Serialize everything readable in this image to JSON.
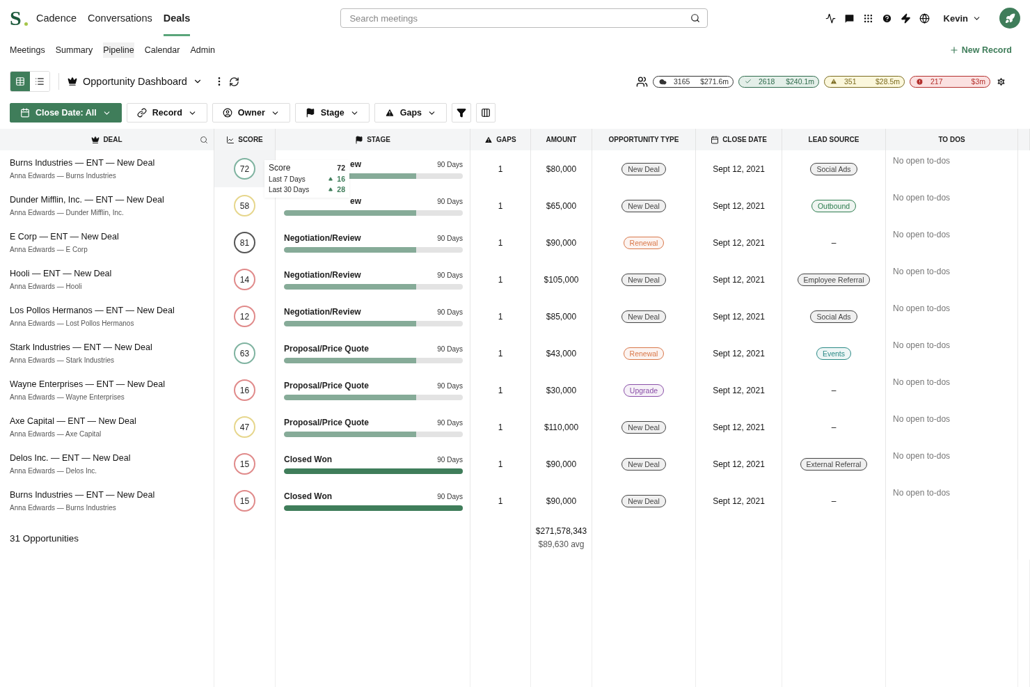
{
  "nav": {
    "logo": "S",
    "items": [
      {
        "label": "Cadence",
        "selected": false
      },
      {
        "label": "Conversations",
        "selected": false
      },
      {
        "label": "Deals",
        "selected": true
      }
    ],
    "search": {
      "placeholder": "Search meetings"
    },
    "user": "Kevin"
  },
  "subnav": {
    "items": [
      {
        "label": "Meetings",
        "selected": false
      },
      {
        "label": "Summary",
        "selected": false
      },
      {
        "label": "Pipeline",
        "selected": true
      },
      {
        "label": "Calendar",
        "selected": false
      },
      {
        "label": "Admin",
        "selected": false
      }
    ],
    "action": "New Record"
  },
  "dashboard": {
    "views": [
      {
        "kind": "grid",
        "selected": true
      },
      {
        "kind": "list",
        "selected": false
      }
    ],
    "title": "Opportunity Dashboard",
    "stats": [
      {
        "kind": "all",
        "count": "3165",
        "amount": "$271.6m"
      },
      {
        "kind": "won",
        "count": "2618",
        "amount": "$240.1m"
      },
      {
        "kind": "warning",
        "count": "351",
        "amount": "$28.5m"
      },
      {
        "kind": "risk",
        "count": "217",
        "amount": "$3m"
      }
    ]
  },
  "filters": [
    {
      "kind": "calendar",
      "label": "Close Date: All",
      "selected": true
    },
    {
      "kind": "record",
      "label": "Record",
      "selected": false
    },
    {
      "kind": "owner",
      "label": "Owner",
      "selected": false
    },
    {
      "kind": "stage",
      "label": "Stage",
      "selected": false
    },
    {
      "kind": "gaps",
      "label": "Gaps",
      "selected": false
    }
  ],
  "table": {
    "columns": [
      {
        "kind": "deal",
        "label": "DEAL"
      },
      {
        "kind": "score",
        "label": "SCORE"
      },
      {
        "kind": "stage",
        "label": "STAGE"
      },
      {
        "kind": "gaps",
        "label": "GAPS"
      },
      {
        "kind": "plain",
        "label": "AMOUNT"
      },
      {
        "kind": "plain",
        "label": "OPPORTUNITY TYPE"
      },
      {
        "kind": "date",
        "label": "CLOSE DATE"
      },
      {
        "kind": "plain",
        "label": "LEAD SOURCE"
      },
      {
        "kind": "plain",
        "label": "TO DOS"
      }
    ],
    "rows": [
      {
        "deal": "Burns Industries — ENT — New Deal",
        "owner": "Anna Edwards — Burns Industries",
        "score": {
          "label": "72",
          "color": "#7fb3a0"
        },
        "stage": "ew",
        "stage_covered": true,
        "level": 0.74,
        "days": "90 Days",
        "gaps": "1",
        "amount": "$80,000",
        "type": {
          "label": "New Deal",
          "color": "#444444"
        },
        "close": "Sept 12, 2021",
        "lead": {
          "label": "Social Ads",
          "color": "#444444"
        },
        "todos": "No open to-dos"
      },
      {
        "deal": "Dunder Mifflin, Inc. — ENT — New Deal",
        "owner": "Anna Edwards — Dunder Mifflin, Inc.",
        "score": {
          "label": "58",
          "color": "#e6d68c"
        },
        "stage": "ew",
        "stage_covered": true,
        "level": 0.74,
        "days": "90 Days",
        "gaps": "1",
        "amount": "$65,000",
        "type": {
          "label": "New Deal",
          "color": "#444444"
        },
        "close": "Sept 12, 2021",
        "lead": {
          "label": "Outbound",
          "color": "#2e7d4f"
        },
        "todos": "No open to-dos"
      },
      {
        "deal": "E Corp — ENT — New Deal",
        "owner": "Anna Edwards — E Corp",
        "score": {
          "label": "81",
          "color": "#555555"
        },
        "stage": "Negotiation/Review",
        "stage_covered": false,
        "level": 0.74,
        "days": "90 Days",
        "gaps": "1",
        "amount": "$90,000",
        "type": {
          "label": "Renewal",
          "color": "#d9784a"
        },
        "close": "Sept 12, 2021",
        "lead": {
          "label": "–"
        },
        "todos": "No open to-dos"
      },
      {
        "deal": "Hooli — ENT — New Deal",
        "owner": "Anna Edwards — Hooli",
        "score": {
          "label": "14",
          "color": "#e08a8a"
        },
        "stage": "Negotiation/Review",
        "stage_covered": false,
        "level": 0.74,
        "days": "90 Days",
        "gaps": "1",
        "amount": "$105,000",
        "type": {
          "label": "New Deal",
          "color": "#444444"
        },
        "close": "Sept 12, 2021",
        "lead": {
          "label": "Employee Referral",
          "color": "#444444"
        },
        "todos": "No open to-dos"
      },
      {
        "deal": "Los Pollos Hermanos — ENT — New Deal",
        "owner": "Anna Edwards — Lost Pollos Hermanos",
        "score": {
          "label": "12",
          "color": "#e08a8a"
        },
        "stage": "Negotiation/Review",
        "stage_covered": false,
        "level": 0.74,
        "days": "90 Days",
        "gaps": "1",
        "amount": "$85,000",
        "type": {
          "label": "New Deal",
          "color": "#444444"
        },
        "close": "Sept 12, 2021",
        "lead": {
          "label": "Social Ads",
          "color": "#444444"
        },
        "todos": "No open to-dos"
      },
      {
        "deal": "Stark Industries — ENT — New Deal",
        "owner": "Anna Edwards — Stark Industries",
        "score": {
          "label": "63",
          "color": "#7fb3a0"
        },
        "stage": "Proposal/Price Quote",
        "stage_covered": false,
        "level": 0.74,
        "days": "90 Days",
        "gaps": "1",
        "amount": "$43,000",
        "type": {
          "label": "Renewal",
          "color": "#d9784a"
        },
        "close": "Sept 12, 2021",
        "lead": {
          "label": "Events",
          "color": "#2a8a86"
        },
        "todos": "No open to-dos"
      },
      {
        "deal": "Wayne Enterprises — ENT — New Deal",
        "owner": "Anna Edwards — Wayne Enterprises",
        "score": {
          "label": "16",
          "color": "#e08a8a"
        },
        "stage": "Proposal/Price Quote",
        "stage_covered": false,
        "level": 0.74,
        "days": "90 Days",
        "gaps": "1",
        "amount": "$30,000",
        "type": {
          "label": "Upgrade",
          "color": "#8a4fa8"
        },
        "close": "Sept 12, 2021",
        "lead": {
          "label": "–"
        },
        "todos": "No open to-dos"
      },
      {
        "deal": "Axe Capital — ENT — New Deal",
        "owner": "Anna Edwards — Axe Capital",
        "score": {
          "label": "47",
          "color": "#e6d68c"
        },
        "stage": "Proposal/Price Quote",
        "stage_covered": false,
        "level": 0.74,
        "days": "90 Days",
        "gaps": "1",
        "amount": "$110,000",
        "type": {
          "label": "New Deal",
          "color": "#444444"
        },
        "close": "Sept 12, 2021",
        "lead": {
          "label": "–"
        },
        "todos": "No open to-dos"
      },
      {
        "deal": "Delos Inc. — ENT — New Deal",
        "owner": "Anna Edwards — Delos Inc.",
        "score": {
          "label": "15",
          "color": "#e08a8a"
        },
        "stage": "Closed Won",
        "stage_covered": false,
        "level": 1,
        "days": "90 Days",
        "gaps": "1",
        "amount": "$90,000",
        "type": {
          "label": "New Deal",
          "color": "#444444"
        },
        "close": "Sept 12, 2021",
        "lead": {
          "label": "External Referral",
          "color": "#444444"
        },
        "todos": "No open to-dos"
      },
      {
        "deal": "Burns Industries — ENT — New Deal",
        "owner": "Anna Edwards — Burns Industries",
        "score": {
          "label": "15",
          "color": "#e08a8a"
        },
        "stage": "Closed Won",
        "stage_covered": false,
        "level": 1,
        "days": "90 Days",
        "gaps": "1",
        "amount": "$90,000",
        "type": {
          "label": "New Deal",
          "color": "#444444"
        },
        "close": "Sept 12, 2021",
        "lead": {
          "label": "–"
        },
        "todos": "No open to-dos"
      }
    ],
    "footer": {
      "count": "31 Opportunities",
      "total": "$271,578,343",
      "average": "$89,630 avg"
    }
  },
  "score_tooltip": {
    "title": "Score",
    "value": "72",
    "rows": [
      {
        "label": "Last 7 Days",
        "value": "16"
      },
      {
        "label": "Last 30 Days",
        "value": "28"
      }
    ]
  }
}
